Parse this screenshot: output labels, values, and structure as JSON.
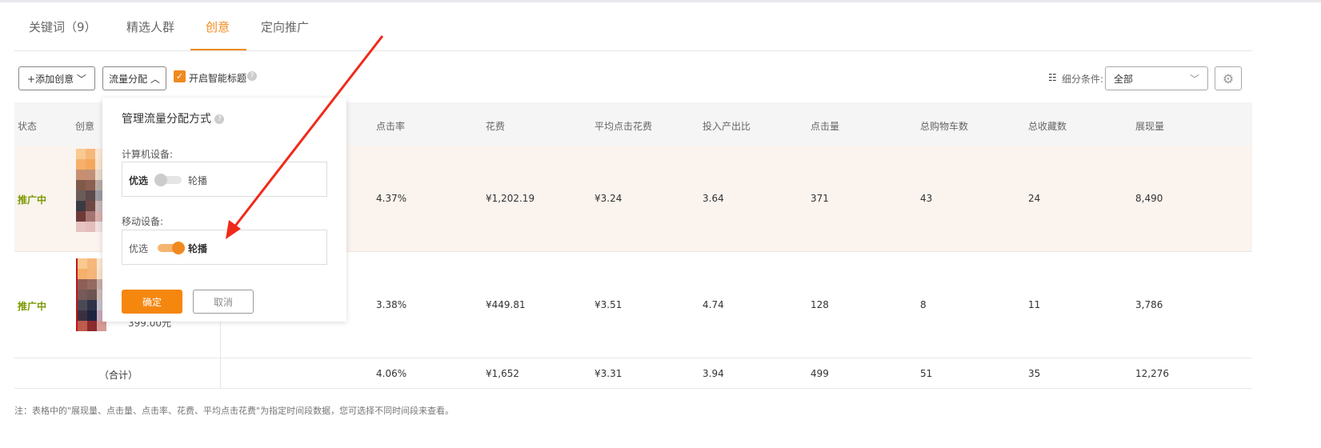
{
  "tabs": [
    {
      "label": "关键词（9）"
    },
    {
      "label": "精选人群"
    },
    {
      "label": "创意"
    },
    {
      "label": "定向推广"
    }
  ],
  "toolbar": {
    "add_label": "+添加创意",
    "traffic_label": "流量分配",
    "smart_title_label": "开启智能标题",
    "filter_label": "细分条件:",
    "filter_value": "全部"
  },
  "table": {
    "headers": [
      "状态",
      "创意",
      "点击率",
      "花费",
      "平均点击花费",
      "投入产出比",
      "点击量",
      "总购物车数",
      "总收藏数",
      "展现量"
    ],
    "rows": [
      {
        "status": "推广中",
        "price": "",
        "values": [
          "4.37%",
          "¥1,202.19",
          "¥3.24",
          "3.64",
          "371",
          "43",
          "24",
          "8,490"
        ]
      },
      {
        "status": "推广中",
        "price": "399.00元",
        "values": [
          "3.38%",
          "¥449.81",
          "¥3.51",
          "4.74",
          "128",
          "8",
          "11",
          "3,786"
        ]
      }
    ],
    "total": {
      "label": "（合计）",
      "values": [
        "4.06%",
        "¥1,652",
        "¥3.31",
        "3.94",
        "499",
        "51",
        "35",
        "12,276"
      ]
    }
  },
  "popover": {
    "title": "管理流量分配方式",
    "pc_label": "计算机设备:",
    "mobile_label": "移动设备:",
    "opt_left": "优选",
    "opt_right": "轮播",
    "pc_value": "优选",
    "mobile_value": "轮播",
    "confirm": "确定",
    "cancel": "取消"
  },
  "footnote": "注：表格中的\"展现量、点击量、点击率、花费、平均点击花费\"为指定时间段数据，您可选择不同时间段来查看。",
  "colors": {
    "accent": "#f08a1e",
    "status": "#7a9a00",
    "arrow": "#f02a1a"
  }
}
